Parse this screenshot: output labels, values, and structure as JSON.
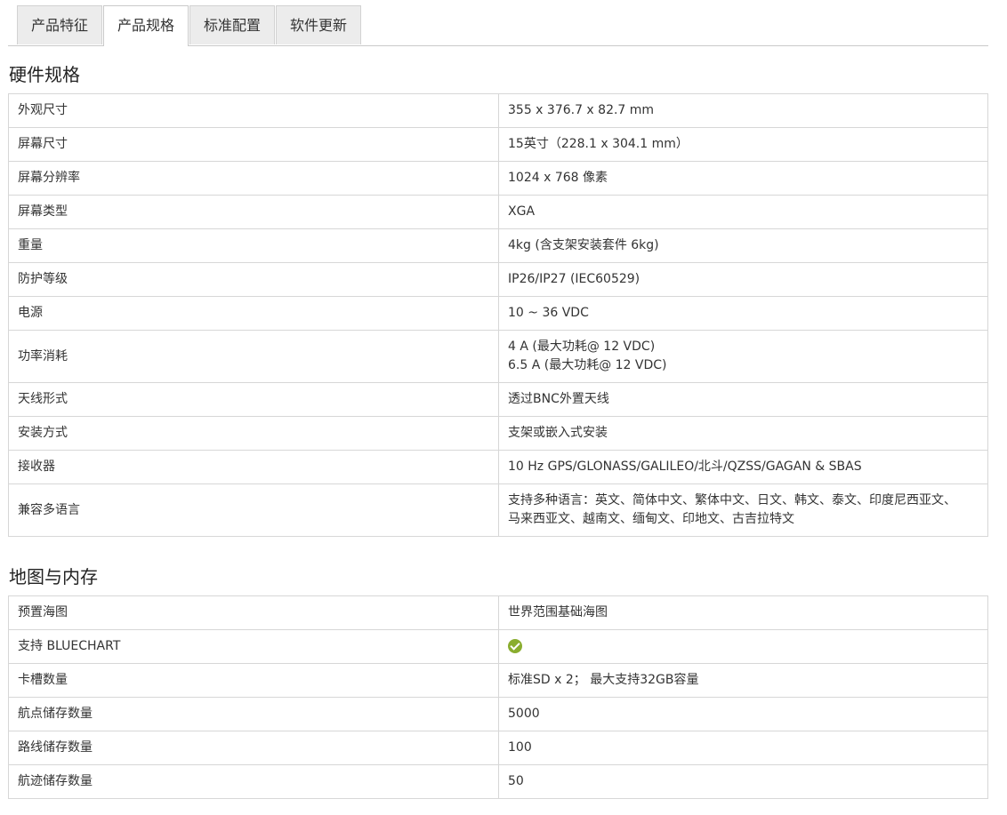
{
  "tabs": [
    "产品特征",
    "产品规格",
    "标准配置",
    "软件更新"
  ],
  "active_tab": "产品规格",
  "hardware": {
    "title": "硬件规格",
    "rows": [
      {
        "k": "外观尺寸",
        "v": "355 x 376.7 x 82.7 mm"
      },
      {
        "k": "屏幕尺寸",
        "v": "15英寸（228.1 x 304.1 mm）"
      },
      {
        "k": "屏幕分辨率",
        "v": "1024 x 768 像素"
      },
      {
        "k": "屏幕类型",
        "v": "XGA"
      },
      {
        "k": "重量",
        "v": "4kg (含支架安装套件 6kg)"
      },
      {
        "k": "防护等级",
        "v": "IP26/IP27 (IEC60529)"
      },
      {
        "k": "电源",
        "v": "10 ~ 36 VDC"
      },
      {
        "k": "功率消耗",
        "v": "4 A (最大功耗@ 12 VDC)",
        "v2": "6.5 A (最大功耗@ 12 VDC)"
      },
      {
        "k": "天线形式",
        "v": "透过BNC外置天线"
      },
      {
        "k": "安装方式",
        "v": "支架或嵌入式安装"
      },
      {
        "k": "接收器",
        "v": "10 Hz GPS/GLONASS/GALILEO/北斗/QZSS/GAGAN & SBAS"
      },
      {
        "k": "兼容多语言",
        "v": "支持多种语言：英文、简体中文、繁体中文、日文、韩文、泰文、印度尼西亚文、",
        "v2": "马来西亚文、越南文、缅甸文、印地文、古吉拉特文"
      }
    ]
  },
  "maps": {
    "title": "地图与内存",
    "rows": [
      {
        "k": "预置海图",
        "v": "世界范围基础海图"
      },
      {
        "k": "支持 BLUECHART",
        "icon": "check-circle-icon",
        "icon_color": "#8aad2f"
      },
      {
        "k": "卡槽数量",
        "v": "标准SD x 2； 最大支持32GB容量"
      },
      {
        "k": "航点储存数量",
        "v": "5000"
      },
      {
        "k": "路线储存数量",
        "v": "100"
      },
      {
        "k": "航迹储存数量",
        "v": "50"
      }
    ]
  }
}
